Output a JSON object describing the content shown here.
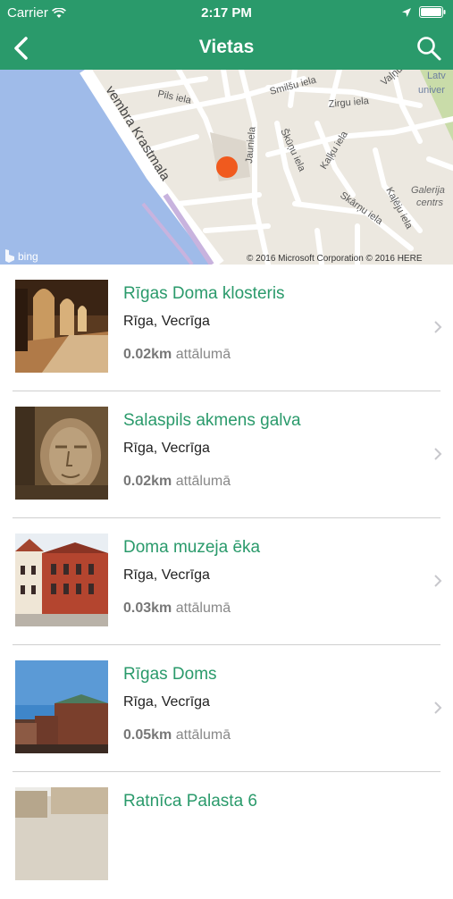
{
  "status": {
    "carrier": "Carrier",
    "time": "2:17 PM"
  },
  "nav": {
    "title": "Vietas"
  },
  "map": {
    "labels": {
      "street_krastmala": "vembra Krastmala",
      "pils": "Pils iela",
      "smilsu": "Smilšu iela",
      "zirgu": "Zirgu iela",
      "jauniela": "Jauniela",
      "skunu": "Škūņu iela",
      "kalku": "Kaļķu iela",
      "kaleju": "Kaļēju iela",
      "skarnu": "Skārņu iela",
      "valnu": "Vaļņu iela",
      "latvijas_univ_1": "Latv",
      "latvijas_univ_2": "univer",
      "galerija_1": "Galerija",
      "galerija_2": "centrs",
      "bing": "bing",
      "copyright": "© 2016 Microsoft Corporation © 2016 HERE"
    }
  },
  "places": [
    {
      "name": "Rīgas Doma klosteris",
      "location": "Rīga, Vecrīga",
      "distance": "0.02km",
      "distance_suffix": "attālumā"
    },
    {
      "name": "Salaspils akmens galva",
      "location": "Rīga, Vecrīga",
      "distance": "0.02km",
      "distance_suffix": "attālumā"
    },
    {
      "name": "Doma muzeja ēka",
      "location": "Rīga, Vecrīga",
      "distance": "0.03km",
      "distance_suffix": "attālumā"
    },
    {
      "name": "Rīgas Doms",
      "location": "Rīga, Vecrīga",
      "distance": "0.05km",
      "distance_suffix": "attālumā"
    },
    {
      "name": "Ratnīca Palasta 6",
      "location": "",
      "distance": "",
      "distance_suffix": ""
    }
  ],
  "colors": {
    "brand": "#2a9a6b",
    "marker": "#f05a1e",
    "water": "#9fbbe9"
  }
}
